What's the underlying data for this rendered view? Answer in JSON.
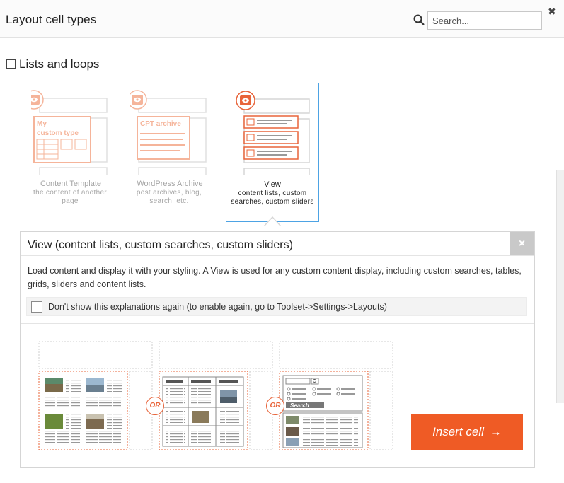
{
  "window": {
    "title": "Layout cell types",
    "search_placeholder": "Search...",
    "close_icon": "close-icon",
    "search_icon": "search-icon"
  },
  "section": {
    "title": "Lists and loops",
    "toggle_icon": "collapse-minus-icon"
  },
  "cell_types": [
    {
      "name": "Content Template",
      "description": "the content of another page",
      "thumb_text": [
        "My",
        "custom type"
      ],
      "selected": false
    },
    {
      "name": "WordPress Archive",
      "description": "post archives, blog, search, etc.",
      "thumb_text": [
        "CPT archive"
      ],
      "selected": false
    },
    {
      "name": "View",
      "description": "content lists, custom searches, custom sliders",
      "selected": true
    }
  ],
  "panel": {
    "title": "View (content lists, custom searches, custom sliders)",
    "close_label": "×",
    "description": "Load content and display it with your styling. A View is used for any custom content display, including custom searches, tables, grids, sliders and content lists.",
    "dont_show_label": "Don't show this explanations again (to enable again, go to Toolset->Settings->Layouts)",
    "dont_show_checked": false
  },
  "examples": {
    "or_label": "OR",
    "search_label": "Search"
  },
  "insert_button": {
    "label": "Insert cell",
    "arrow": "→"
  },
  "colors": {
    "accent": "#ef5b25",
    "selected_border": "#4da3e4",
    "faded_orange": "#f7b8a0"
  }
}
